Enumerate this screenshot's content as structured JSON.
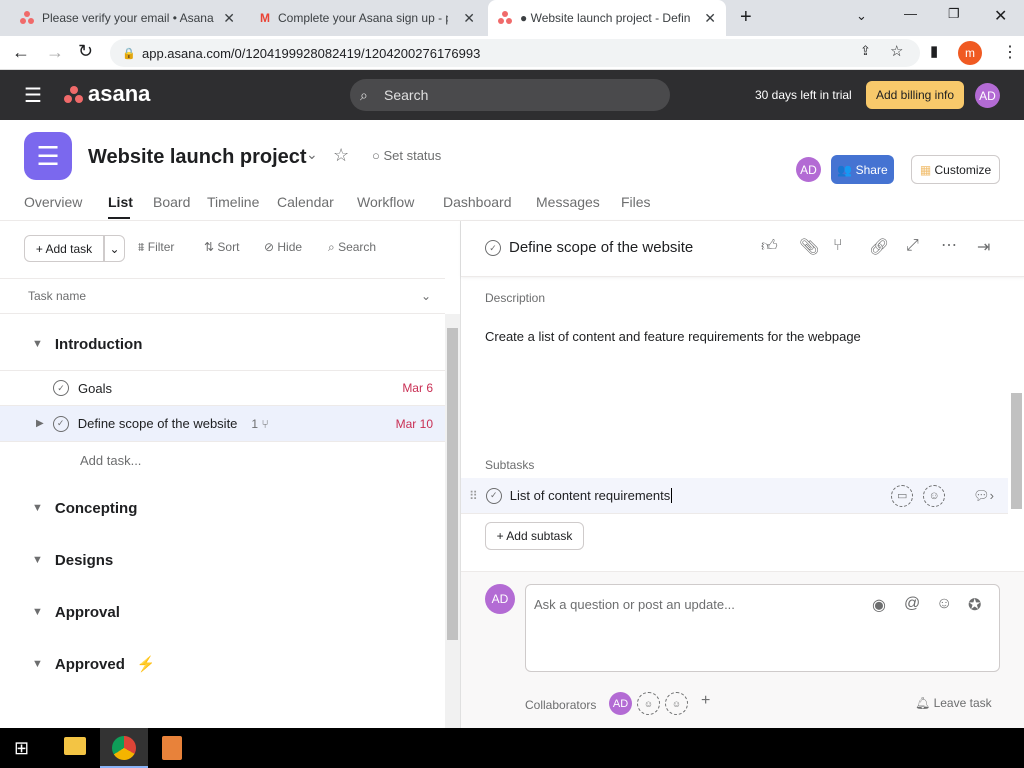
{
  "browser": {
    "tabs": [
      {
        "title": "Please verify your email • Asana"
      },
      {
        "title": "Complete your Asana sign up - p"
      },
      {
        "title": "● Website launch project - Define"
      }
    ],
    "url": "app.asana.com/0/1204199928082419/1204200276176993",
    "profile": "m"
  },
  "topbar": {
    "logo": "asana",
    "search_placeholder": "Search",
    "trial": "30 days left in trial",
    "billing": "Add billing info",
    "avatar": "AD"
  },
  "project": {
    "title": "Website launch project",
    "set_status": "Set status",
    "avatar": "AD",
    "share": "Share",
    "customize": "Customize",
    "accent": "#7b68ee",
    "tabs": [
      "Overview",
      "List",
      "Board",
      "Timeline",
      "Calendar",
      "Workflow",
      "Dashboard",
      "Messages",
      "Files"
    ],
    "active_tab": "List"
  },
  "toolbar": {
    "add_task": "+ Add task",
    "filter": "Filter",
    "sort": "Sort",
    "hide": "Hide",
    "search": "Search"
  },
  "list": {
    "column": "Task name",
    "sections": [
      {
        "name": "Introduction"
      },
      {
        "name": "Concepting"
      },
      {
        "name": "Designs"
      },
      {
        "name": "Approval"
      },
      {
        "name": "Approved",
        "emoji": "⚡"
      }
    ],
    "tasks": [
      {
        "name": "Goals",
        "date": "Mar 6"
      },
      {
        "name": "Define scope of the website",
        "subtasks": "1",
        "date": "Mar 10"
      }
    ],
    "add_task": "Add task..."
  },
  "detail": {
    "title": "Define scope of the website",
    "description_label": "Description",
    "description": "Create a list of content and feature requirements for the webpage",
    "subtasks_label": "Subtasks",
    "subtask": "List of content requirements",
    "add_subtask": "+ Add subtask",
    "comment_placeholder": "Ask a question or post an update...",
    "avatar": "AD",
    "collaborators": "Collaborators",
    "leave": "Leave task"
  }
}
